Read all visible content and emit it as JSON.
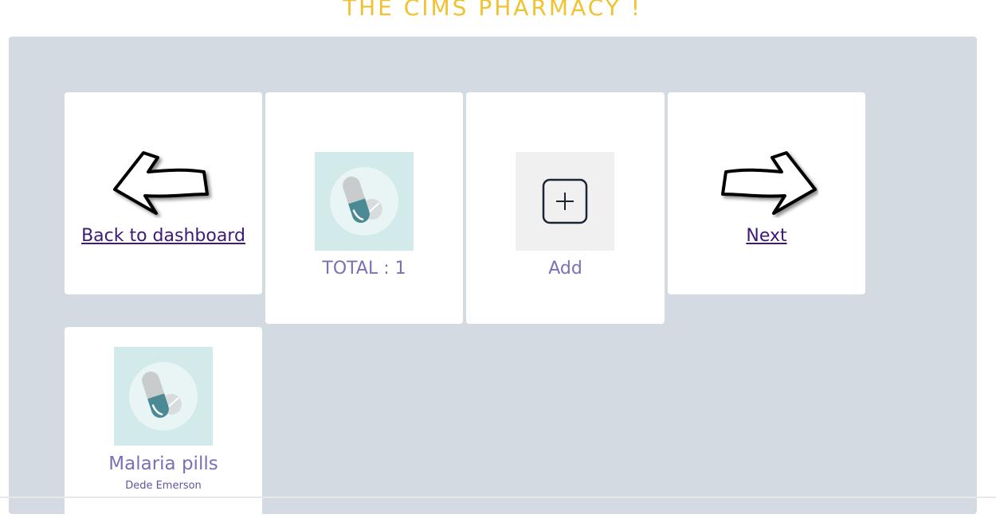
{
  "header": {
    "title": "THE CIMS PHARMACY !"
  },
  "cards": {
    "back": {
      "label": "Back to dashboard",
      "icon": "left-arrow-icon"
    },
    "total": {
      "label": "TOTAL : 1",
      "icon": "pill-icon"
    },
    "add": {
      "label": "Add",
      "icon": "plus-square-icon"
    },
    "next": {
      "label": "Next",
      "icon": "right-arrow-icon"
    }
  },
  "items": [
    {
      "name": "Malaria pills",
      "owner": "Dede Emerson",
      "icon": "pill-icon"
    }
  ],
  "colors": {
    "title": "#f2c12e",
    "panel": "#d3dae2",
    "link": "#3e1a78",
    "label": "#7b6fb6",
    "pill_bg": "#d2ebea",
    "pill_teal": "#4b8a94"
  }
}
